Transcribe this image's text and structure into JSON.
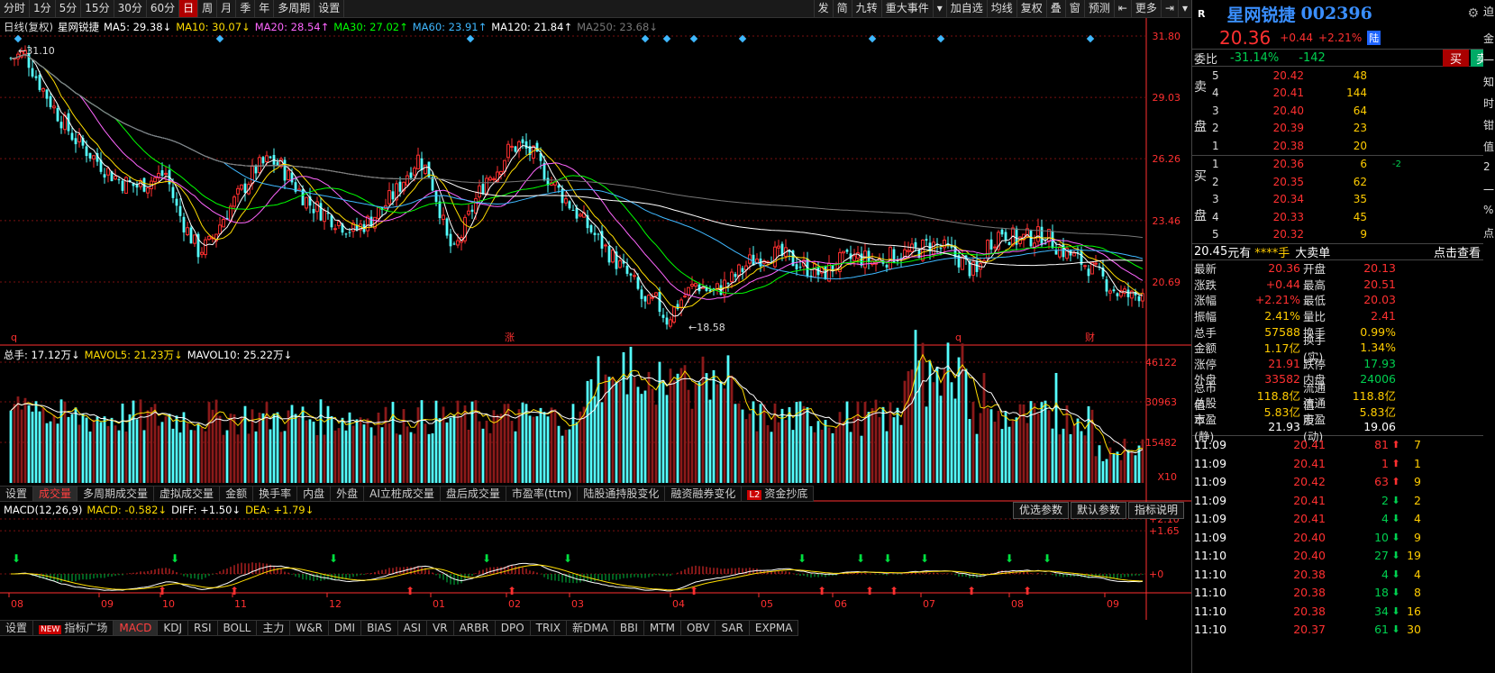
{
  "toolbar": {
    "periods": [
      "分时",
      "1分",
      "5分",
      "15分",
      "30分",
      "60分",
      "日",
      "周",
      "月",
      "季",
      "年",
      "多周期",
      "设置"
    ],
    "active": "日",
    "right": [
      "发",
      "简",
      "九转",
      "重大事件",
      "▾",
      "加自选",
      "均线",
      "复权",
      "叠",
      "窗",
      "预测",
      "⇤",
      "更多",
      "⇥",
      "▾"
    ]
  },
  "price_legend": {
    "prefix": "日线(复权)",
    "stock": "星网锐捷",
    "ma": [
      {
        "t": "MA5: 29.38↓",
        "c": "#ffffff"
      },
      {
        "t": "MA10: 30.07↓",
        "c": "#ffdd00"
      },
      {
        "t": "MA20: 28.54↑",
        "c": "#ff66ff"
      },
      {
        "t": "MA30: 27.02↑",
        "c": "#00ff00"
      },
      {
        "t": "MA60: 23.91↑",
        "c": "#3fb8ff"
      },
      {
        "t": "MA120: 21.84↑",
        "c": "#ffffff"
      },
      {
        "t": "MA250: 23.68↓",
        "c": "#777777"
      }
    ]
  },
  "vol_legend": [
    {
      "t": "总手: 17.12万↓",
      "c": "#ffffff"
    },
    {
      "t": "MAVOL5: 21.23万↓",
      "c": "#ffdd00"
    },
    {
      "t": "MAVOL10: 25.22万↓",
      "c": "#ffffff"
    }
  ],
  "macd_legend": [
    {
      "t": "MACD(12,26,9)",
      "c": "#ffffff"
    },
    {
      "t": "MACD: -0.582↓",
      "c": "#ffdd00"
    },
    {
      "t": "DIFF: +1.50↓",
      "c": "#ffffff"
    },
    {
      "t": "DEA: +1.79↓",
      "c": "#ffdd00"
    }
  ],
  "price_axis": [
    "31.80",
    "29.03",
    "26.26",
    "23.46",
    "20.69"
  ],
  "vol_axis": [
    "46122",
    "30963",
    "15482",
    "X10"
  ],
  "macd_axis": [
    "+2.10",
    "+1.65",
    "+0"
  ],
  "high_label": "31.10",
  "low_label": "18.58",
  "markers": [
    "q",
    "涨",
    "q",
    "财"
  ],
  "months": [
    "08",
    "09",
    "10",
    "11",
    "12",
    "01",
    "02",
    "03",
    "04",
    "05",
    "06",
    "07",
    "08",
    "09"
  ],
  "vol_tabs": [
    "设置",
    "成交量",
    "多周期成交量",
    "虚拟成交量",
    "金额",
    "换手率",
    "内盘",
    "外盘",
    "AI立桩成交量",
    "盘后成交量",
    "市盈率(ttm)",
    "陆股通持股变化",
    "融资融券变化",
    "资金抄底"
  ],
  "vol_tab_active": "成交量",
  "l2_badge": "L2",
  "param_buttons": [
    "优选参数",
    "默认参数",
    "指标说明"
  ],
  "bottom_tabs": [
    "设置",
    "指标广场",
    "MACD",
    "KDJ",
    "RSI",
    "BOLL",
    "主力",
    "W&R",
    "DMI",
    "BIAS",
    "ASI",
    "VR",
    "ARBR",
    "DPO",
    "TRIX",
    "新DMA",
    "BBI",
    "MTM",
    "OBV",
    "SAR",
    "EXPMA"
  ],
  "bottom_tab_active": "MACD",
  "new_badge": "NEW",
  "chart_data": {
    "type": "candlestick",
    "ma_values": {
      "MA5": 29.38,
      "MA10": 30.07,
      "MA20": 28.54,
      "MA30": 27.02,
      "MA60": 23.91,
      "MA120": 21.84,
      "MA250": 23.68
    },
    "high": 31.1,
    "low": 18.58,
    "last": 20.36,
    "ylim": [
      18.0,
      32.4
    ],
    "volume_max": 46122,
    "macd": {
      "MACD": -0.582,
      "DIFF": 1.5,
      "DEA": 1.79
    }
  },
  "quote": {
    "r": "R",
    "name": "星网锐捷",
    "code": "002396",
    "price": "20.36",
    "chg": "+0.44",
    "pct": "+2.21%",
    "tag": "陆",
    "webi_label": "委比",
    "webi": "-31.14%",
    "weicha": "-142",
    "buy_btn": "买",
    "sell_btn": "卖",
    "sell_side": "卖盘",
    "buy_side": "买盘",
    "asks": [
      {
        "lv": "5",
        "p": "20.42",
        "v": "48"
      },
      {
        "lv": "4",
        "p": "20.41",
        "v": "144"
      },
      {
        "lv": "3",
        "p": "20.40",
        "v": "64"
      },
      {
        "lv": "2",
        "p": "20.39",
        "v": "23"
      },
      {
        "lv": "1",
        "p": "20.38",
        "v": "20"
      }
    ],
    "bids": [
      {
        "lv": "1",
        "p": "20.36",
        "v": "6"
      },
      {
        "lv": "2",
        "p": "20.35",
        "v": "62"
      },
      {
        "lv": "3",
        "p": "20.34",
        "v": "35"
      },
      {
        "lv": "4",
        "p": "20.33",
        "v": "45"
      },
      {
        "lv": "5",
        "p": "20.32",
        "v": "9"
      }
    ],
    "bid1_extra": "-2",
    "mid_price": "20.45",
    "mid_text": "元有",
    "mid_stars": "****手",
    "mid_big": "大卖单",
    "mid_link": "点击查看",
    "stats": [
      [
        "最新",
        "20.36",
        "red",
        "开盘",
        "20.13",
        "red"
      ],
      [
        "涨跌",
        "+0.44",
        "red",
        "最高",
        "20.51",
        "red"
      ],
      [
        "涨幅",
        "+2.21%",
        "red",
        "最低",
        "20.03",
        "red"
      ],
      [
        "振幅",
        "2.41%",
        "yel",
        "量比",
        "2.41",
        "red"
      ],
      [
        "总手",
        "57588",
        "yel",
        "换手",
        "0.99%",
        "yel"
      ],
      [
        "金额",
        "1.17亿",
        "yel",
        "换手(实)",
        "1.34%",
        "yel"
      ],
      [
        "涨停",
        "21.91",
        "red",
        "跌停",
        "17.93",
        "green"
      ],
      [
        "外盘",
        "33582",
        "red",
        "内盘",
        "24006",
        "green"
      ],
      [
        "总市值",
        "118.8亿",
        "yel",
        "流通值",
        "118.8亿",
        "yel"
      ],
      [
        "总股本",
        "5.83亿",
        "yel",
        "流通股",
        "5.83亿",
        "yel"
      ],
      [
        "市盈(静)",
        "21.93",
        "wht",
        "市盈(动)",
        "19.06",
        "wht"
      ]
    ],
    "ticks": [
      [
        "11:09",
        "20.41",
        "81",
        "up",
        "7"
      ],
      [
        "11:09",
        "20.41",
        "1",
        "up",
        "1"
      ],
      [
        "11:09",
        "20.42",
        "63",
        "up",
        "9"
      ],
      [
        "11:09",
        "20.41",
        "2",
        "dn",
        "2"
      ],
      [
        "11:09",
        "20.41",
        "4",
        "dn",
        "4"
      ],
      [
        "11:09",
        "20.40",
        "10",
        "dn",
        "9"
      ],
      [
        "11:10",
        "20.40",
        "27",
        "dn",
        "19"
      ],
      [
        "11:10",
        "20.38",
        "4",
        "dn",
        "4"
      ],
      [
        "11:10",
        "20.38",
        "18",
        "dn",
        "8"
      ],
      [
        "11:10",
        "20.38",
        "34",
        "dn",
        "16"
      ],
      [
        "11:10",
        "20.37",
        "61",
        "dn",
        "30"
      ]
    ],
    "edge_text": [
      "迫",
      "金",
      "一",
      "知",
      "时",
      "钳",
      "值",
      "2",
      "一",
      "%",
      "点"
    ]
  },
  "colors": {
    "up": "#ff3030",
    "down": "#54ffff",
    "grid": "#7a1010",
    "axis": "#ff3030"
  }
}
